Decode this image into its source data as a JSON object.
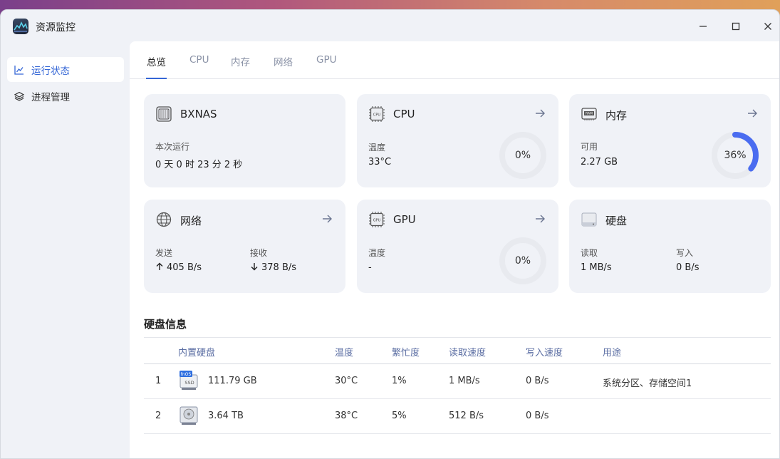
{
  "window": {
    "title": "资源监控"
  },
  "sidebar": {
    "items": [
      {
        "label": "运行状态",
        "icon": "line-chart-icon",
        "active": true
      },
      {
        "label": "进程管理",
        "icon": "layers-icon",
        "active": false
      }
    ]
  },
  "tabs": [
    {
      "label": "总览",
      "active": true
    },
    {
      "label": "CPU",
      "active": false
    },
    {
      "label": "内存",
      "active": false
    },
    {
      "label": "网络",
      "active": false
    },
    {
      "label": "GPU",
      "active": false
    }
  ],
  "cards": {
    "system": {
      "title": "BXNAS",
      "uptime_label": "本次运行",
      "uptime_value": "0 天 0 时 23 分 2 秒"
    },
    "cpu": {
      "title": "CPU",
      "temp_label": "温度",
      "temp_value": "33°C",
      "usage": "0%",
      "usage_fraction": 0
    },
    "memory": {
      "title": "内存",
      "avail_label": "可用",
      "avail_value": "2.27 GB",
      "usage": "36%",
      "usage_fraction": 0.36
    },
    "network": {
      "title": "网络",
      "send_label": "发送",
      "send_value": "405 B/s",
      "recv_label": "接收",
      "recv_value": "378 B/s"
    },
    "gpu": {
      "title": "GPU",
      "temp_label": "温度",
      "temp_value": "-",
      "usage": "0%",
      "usage_fraction": 0
    },
    "disk": {
      "title": "硬盘",
      "read_label": "读取",
      "read_value": "1 MB/s",
      "write_label": "写入",
      "write_value": "0 B/s"
    }
  },
  "disk_info": {
    "title": "硬盘信息",
    "columns": [
      "内置硬盘",
      "温度",
      "繁忙度",
      "读取速度",
      "写入速度",
      "用途"
    ],
    "rows": [
      {
        "index": "1",
        "type": "ssd",
        "badge": "fnOS",
        "badge2": "SSD",
        "size": "111.79 GB",
        "temp": "30°C",
        "busy": "1%",
        "read": "1 MB/s",
        "write": "0 B/s",
        "usage": "系统分区、存储空间1"
      },
      {
        "index": "2",
        "type": "hdd",
        "size": "3.64 TB",
        "temp": "38°C",
        "busy": "5%",
        "read": "512 B/s",
        "write": "0 B/s",
        "usage": ""
      }
    ]
  },
  "colors": {
    "accent": "#3466d6",
    "ring_track": "#e8eaef",
    "ring_fill": "#4a6cf0"
  }
}
